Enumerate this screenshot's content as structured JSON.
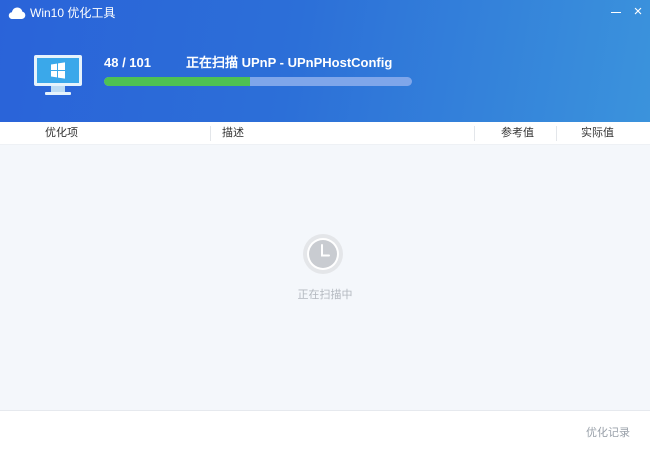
{
  "window": {
    "title": "Win10 优化工具",
    "close_glyph": "×",
    "accent_color": "#2a63d9",
    "progress_color": "#4ec153"
  },
  "scan": {
    "current": 48,
    "total": 101,
    "progress_text": "48 / 101",
    "status_text": "正在扫描 UPnP - UPnPHostConfig"
  },
  "table": {
    "columns": [
      "优化项",
      "描述",
      "参考值",
      "实际值"
    ]
  },
  "empty_state": {
    "icon": "clock-icon",
    "text": "正在扫描中"
  },
  "footer": {
    "history_label": "优化记录"
  }
}
